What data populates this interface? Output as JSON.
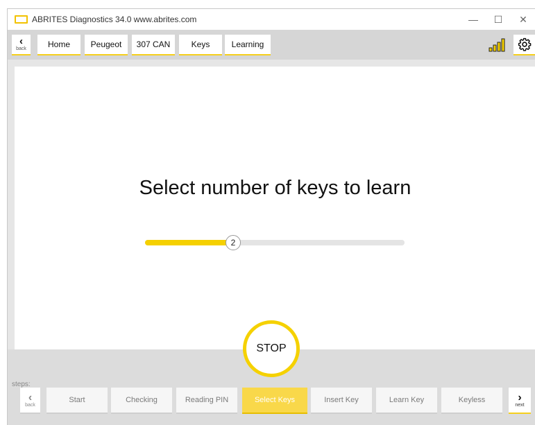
{
  "window": {
    "title": "ABRITES Diagnostics 34.0   www.abrites.com",
    "minimize_glyph": "—",
    "maximize_glyph": "☐",
    "close_glyph": "✕"
  },
  "nav": {
    "back_label": "back",
    "back_glyph": "‹",
    "breadcrumbs": [
      "Home",
      "Peugeot",
      "307 CAN",
      "Keys",
      "Learning"
    ],
    "signal_icon": "signal-bars-icon",
    "settings_icon": "gear-icon"
  },
  "main": {
    "heading": "Select number of keys to learn",
    "slider": {
      "value": "2",
      "fraction": 0.34
    }
  },
  "stop": {
    "label": "STOP"
  },
  "steps": {
    "label": "steps:",
    "back_label": "back",
    "back_glyph": "‹",
    "next_label": "next",
    "next_glyph": "›",
    "items": [
      "Start",
      "Checking",
      "Reading PIN",
      "Select Keys",
      "Insert Key",
      "Learn Key",
      "Keyless"
    ],
    "active": "Select Keys"
  },
  "colors": {
    "accent": "#f5d000",
    "active_step": "#f9d84a",
    "nav_bg": "#d6d6d6",
    "bottom_bg": "#dcdcdc"
  }
}
